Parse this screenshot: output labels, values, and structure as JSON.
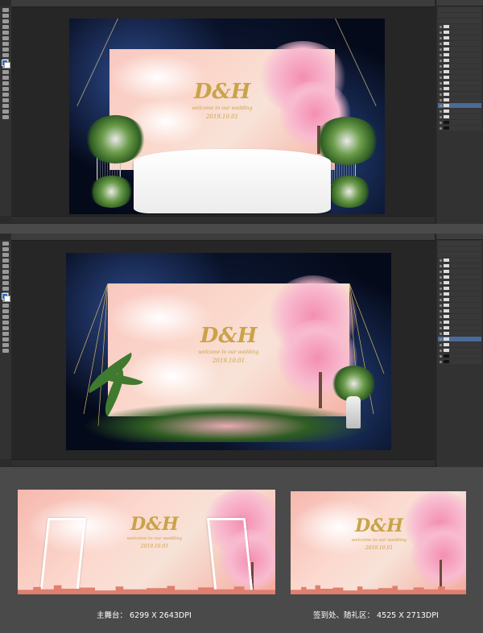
{
  "window1": {
    "doc_tab": "",
    "status": "",
    "panel_title": "",
    "layers": [
      "",
      "",
      "",
      "",
      "",
      "",
      "",
      "",
      "",
      "",
      "",
      "",
      "",
      "",
      "",
      "",
      "",
      "",
      ""
    ]
  },
  "window2": {
    "doc_tab": "",
    "status": "",
    "panel_title": "",
    "layers": [
      "",
      "",
      "",
      "",
      "",
      "",
      "",
      "",
      "",
      "",
      "",
      "",
      "",
      "",
      "",
      "",
      "",
      "",
      ""
    ]
  },
  "design": {
    "monogram": "D&H",
    "welcome": "welcome to our wedding",
    "date": "2019.10.01"
  },
  "captions": {
    "main_stage": "主舞台：  6299 X 2643DPI",
    "sign_in": "签到处、随礼区：  4525 X 2713DPI"
  },
  "colors": {
    "gold_text": "#c9a349",
    "pink_backdrop": "#f9c8c0",
    "night_sky": "#0f1d3d",
    "skyline": "#e07f6f",
    "page_bg": "#4a4a4a"
  }
}
